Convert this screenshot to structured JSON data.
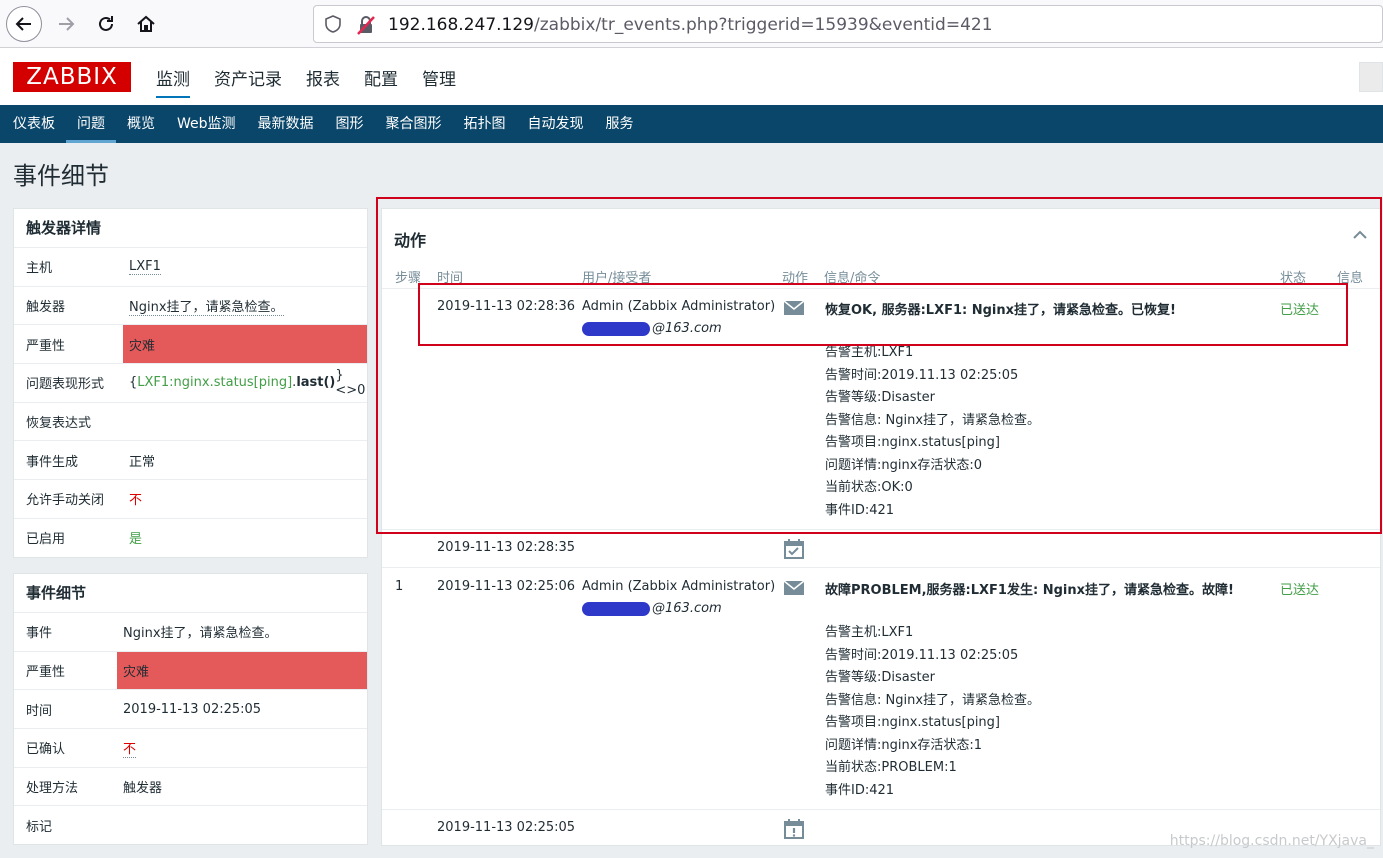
{
  "browser": {
    "url_host": "192.168.247.129",
    "url_path": "/zabbix/tr_events.php?triggerid=15939&eventid=421"
  },
  "header": {
    "logo": "ZABBIX",
    "main_menu": [
      "监测",
      "资产记录",
      "报表",
      "配置",
      "管理"
    ],
    "sub_menu": [
      "仪表板",
      "问题",
      "概览",
      "Web监测",
      "最新数据",
      "图形",
      "聚合图形",
      "拓扑图",
      "自动发现",
      "服务"
    ]
  },
  "page_title": "事件细节",
  "trigger_details": {
    "title": "触发器详情",
    "rows": [
      {
        "label": "主机",
        "value": "LXF1"
      },
      {
        "label": "触发器",
        "value": "Nginx挂了，请紧急检查。"
      },
      {
        "label": "严重性",
        "value": "灾难"
      },
      {
        "label": "问题表现形式",
        "expr_open": "{",
        "expr_item": "LXF1:nginx.status[ping]",
        "expr_dot": ".",
        "expr_func": "last()",
        "expr_close": "}<>0"
      },
      {
        "label": "恢复表达式",
        "value": ""
      },
      {
        "label": "事件生成",
        "value": "正常"
      },
      {
        "label": "允许手动关闭",
        "value": "不"
      },
      {
        "label": "已启用",
        "value": "是"
      }
    ]
  },
  "event_details": {
    "title": "事件细节",
    "rows": [
      {
        "label": "事件",
        "value": "Nginx挂了，请紧急检查。"
      },
      {
        "label": "严重性",
        "value": "灾难"
      },
      {
        "label": "时间",
        "value": "2019-11-13 02:25:05"
      },
      {
        "label": "已确认",
        "value": "不"
      },
      {
        "label": "处理方法",
        "value": "触发器"
      },
      {
        "label": "标记",
        "value": ""
      }
    ]
  },
  "actions": {
    "title": "动作",
    "columns": [
      "步骤",
      "时间",
      "用户/接受者",
      "动作",
      "信息/命令",
      "状态",
      "信息"
    ],
    "rows": [
      {
        "step": "",
        "time": "2019-11-13 02:28:36",
        "user": "Admin (Zabbix Administrator)",
        "email_suffix": "@163.com",
        "action_icon": "envelope-icon",
        "subject": "恢复OK, 服务器:LXF1: Nginx挂了，请紧急检查。已恢复!",
        "status": "已送达",
        "message": [
          "告警主机:LXF1",
          "告警时间:2019.11.13 02:25:05",
          "告警等级:Disaster",
          "告警信息: Nginx挂了，请紧急检查。",
          "告警项目:nginx.status[ping]",
          "问题详情:nginx存活状态:0",
          "当前状态:OK:0",
          "事件ID:421"
        ]
      },
      {
        "step": "",
        "time": "2019-11-13 02:28:35",
        "action_icon": "calendar-check-icon"
      },
      {
        "step": "1",
        "time": "2019-11-13 02:25:06",
        "user": "Admin (Zabbix Administrator)",
        "email_suffix": "@163.com",
        "action_icon": "envelope-icon",
        "subject": "故障PROBLEM,服务器:LXF1发生: Nginx挂了，请紧急检查。故障!",
        "status": "已送达",
        "message": [
          "告警主机:LXF1",
          "告警时间:2019.11.13 02:25:05",
          "告警等级:Disaster",
          "告警信息: Nginx挂了，请紧急检查。",
          "告警项目:nginx.status[ping]",
          "问题详情:nginx存活状态:1",
          "当前状态:PROBLEM:1",
          "事件ID:421"
        ]
      },
      {
        "step": "",
        "time": "2019-11-13 02:25:05",
        "action_icon": "calendar-alert-icon"
      }
    ]
  },
  "watermark": "https://blog.csdn.net/YXjava_",
  "colors": {
    "disaster": "#e45959",
    "header_blue": "#0a466a",
    "logo_red": "#d40000",
    "delivered_green": "#429e47"
  }
}
